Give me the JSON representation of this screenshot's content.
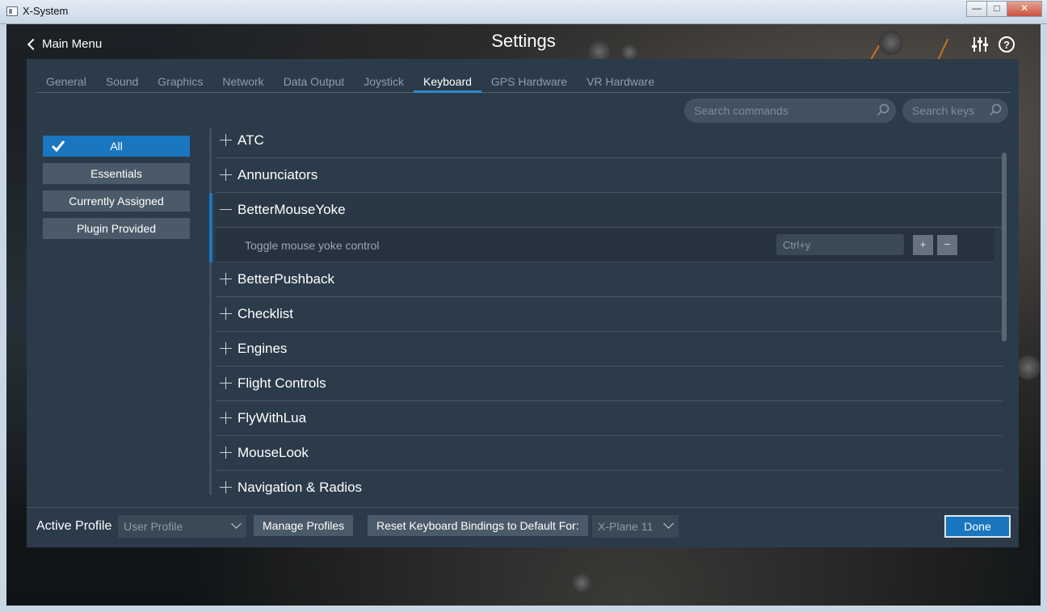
{
  "window": {
    "title": "X-System",
    "minimize": "—",
    "maximize": "□",
    "close": "✕"
  },
  "header": {
    "back_label": "Main Menu",
    "title": "Settings",
    "help_label": "?"
  },
  "tabs": [
    {
      "label": "General"
    },
    {
      "label": "Sound"
    },
    {
      "label": "Graphics"
    },
    {
      "label": "Network"
    },
    {
      "label": "Data Output"
    },
    {
      "label": "Joystick"
    },
    {
      "label": "Keyboard",
      "active": true
    },
    {
      "label": "GPS Hardware"
    },
    {
      "label": "VR Hardware"
    }
  ],
  "search": {
    "commands_placeholder": "Search commands",
    "keys_placeholder": "Search keys"
  },
  "filters": [
    {
      "label": "All",
      "active": true
    },
    {
      "label": "Essentials"
    },
    {
      "label": "Currently Assigned"
    },
    {
      "label": "Plugin Provided"
    }
  ],
  "categories": [
    {
      "label": "ATC"
    },
    {
      "label": "Annunciators"
    },
    {
      "label": "BetterMouseYoke",
      "expanded": true
    },
    {
      "label": "BetterPushback"
    },
    {
      "label": "Checklist"
    },
    {
      "label": "Engines"
    },
    {
      "label": "Flight Controls"
    },
    {
      "label": "FlyWithLua"
    },
    {
      "label": "MouseLook"
    },
    {
      "label": "Navigation & Radios"
    }
  ],
  "expanded_command": {
    "label": "Toggle mouse yoke control",
    "key": "Ctrl+y",
    "add_label": "+",
    "remove_label": "−"
  },
  "footer": {
    "active_profile_label": "Active Profile",
    "profile_value": "User Profile",
    "manage_profiles_label": "Manage Profiles",
    "reset_label": "Reset Keyboard Bindings to Default For:",
    "reset_target_value": "X-Plane 11",
    "done_label": "Done"
  },
  "colors": {
    "panel": "#2c3b4a",
    "accent": "#1b76c0",
    "button": "#4b5a68"
  }
}
